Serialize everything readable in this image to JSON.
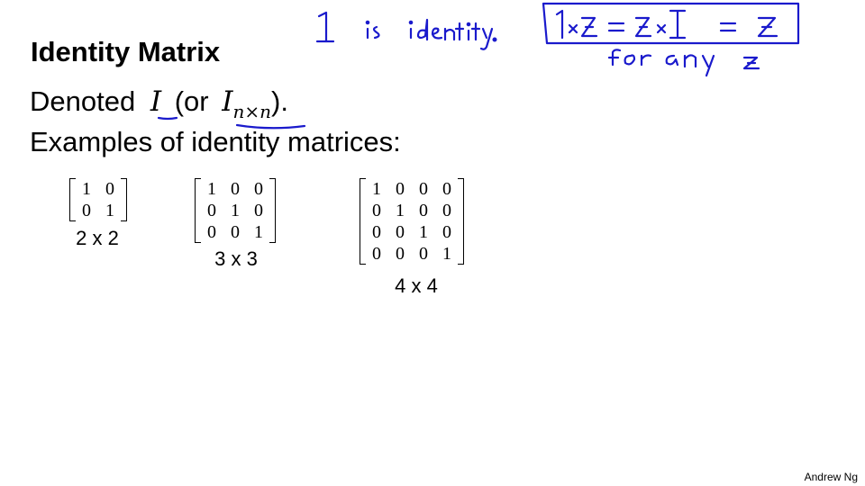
{
  "slide": {
    "title": "Identity Matrix",
    "denoted": {
      "prefix": "Denoted",
      "symbol": "I",
      "paren_open": "(or",
      "symbol2": "I",
      "subscript": "n×n",
      "paren_close": ")."
    },
    "examples_heading": "Examples of identity matrices:",
    "matrices": [
      {
        "rows": [
          [
            "1",
            "0"
          ],
          [
            "0",
            "1"
          ]
        ],
        "label": "2 x 2"
      },
      {
        "rows": [
          [
            "1",
            "0",
            "0"
          ],
          [
            "0",
            "1",
            "0"
          ],
          [
            "0",
            "0",
            "1"
          ]
        ],
        "label": "3 x 3"
      },
      {
        "rows": [
          [
            "1",
            "0",
            "0",
            "0"
          ],
          [
            "0",
            "1",
            "0",
            "0"
          ],
          [
            "0",
            "0",
            "1",
            "0"
          ],
          [
            "0",
            "0",
            "0",
            "1"
          ]
        ],
        "label": "4 x 4"
      }
    ],
    "author": "Andrew Ng"
  },
  "annotations": {
    "note_identity": "1 is identity.",
    "boxed_equation": "1×z = z×1 = z",
    "for_any": "for any z"
  },
  "colors": {
    "ink": "#1a1acc",
    "text": "#000000"
  }
}
